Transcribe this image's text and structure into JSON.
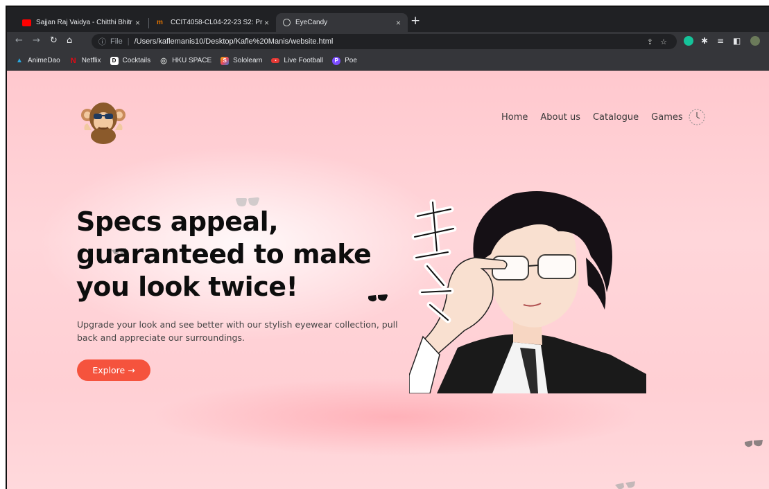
{
  "tabs": [
    {
      "label": "Sajjan Raj Vaidya - Chitthi Bhitr",
      "close": "×",
      "icon_color": "#ff0000"
    },
    {
      "label": "CCIT4058-CL04-22-23 S2: Pr",
      "close": "×",
      "icon_color": "#e37400"
    },
    {
      "label": "EyeCandy",
      "close": "×",
      "icon_color": "#9aa0a6"
    }
  ],
  "new_tab": "+",
  "address": {
    "scheme": "File",
    "path": "/Users/kaflemanis10/Desktop/Kafle%20Manis/website.html"
  },
  "bookmarks": [
    {
      "label": "AnimeDao",
      "icon": "paper-plane-icon",
      "color": "#2aa8e0",
      "glyph": "▲"
    },
    {
      "label": "Netflix",
      "icon": "netflix-icon",
      "color": "#e50914",
      "glyph": "N"
    },
    {
      "label": "Cocktails",
      "icon": "cocktails-icon",
      "color": "#1f1f1f",
      "glyph": "D"
    },
    {
      "label": "HKU SPACE",
      "icon": "globe-icon",
      "color": "#5f6368",
      "glyph": "◎"
    },
    {
      "label": "Sololearn",
      "icon": "sololearn-icon",
      "color": "#3a7bd5",
      "glyph": "S"
    },
    {
      "label": "Live Football",
      "icon": "live-icon",
      "color": "#e53935",
      "glyph": "▪"
    },
    {
      "label": "Poe",
      "icon": "poe-icon",
      "color": "#7c4dff",
      "glyph": "P"
    }
  ],
  "site": {
    "nav": [
      "Home",
      "About us",
      "Catalogue",
      "Games"
    ],
    "headline_lines": [
      "Specs appeal,",
      "guaranteed to make",
      "you look twice!"
    ],
    "subtext": "Upgrade your look and see better with our stylish eyewear collection, pull back and appreciate our surroundings.",
    "cta": "Explore →",
    "accent": "#f5533d"
  }
}
